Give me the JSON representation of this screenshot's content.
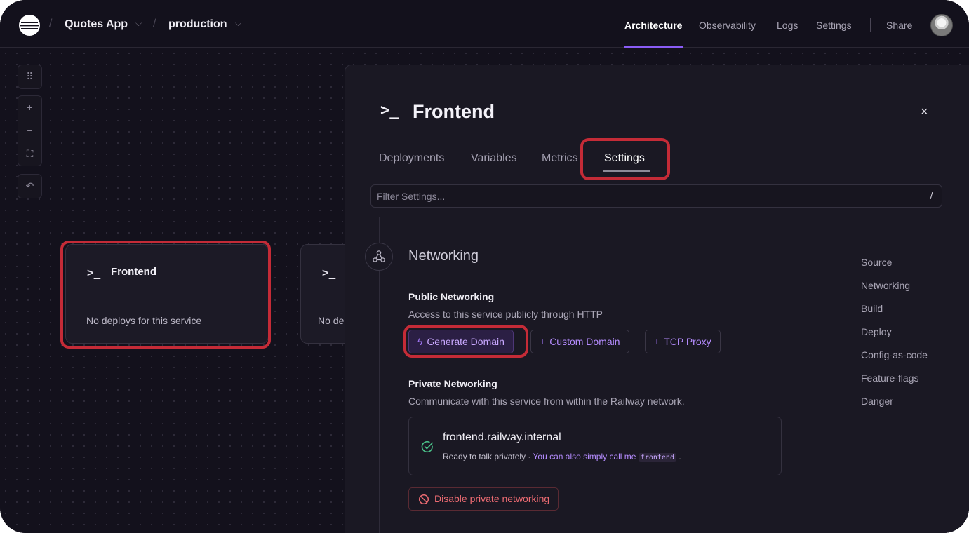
{
  "header": {
    "project": "Quotes App",
    "environment": "production",
    "nav": [
      "Architecture",
      "Observability",
      "Logs",
      "Settings"
    ],
    "share": "Share"
  },
  "canvas": {
    "controls": {
      "grid": "⠿",
      "zoom_in": "+",
      "zoom_out": "−",
      "fit": "⛶",
      "undo": "↶"
    },
    "cards": [
      {
        "prompt": ">_",
        "name": "Frontend",
        "message": "No deploys for this service"
      },
      {
        "prompt": ">_",
        "name": "",
        "message": "No de"
      }
    ]
  },
  "panel": {
    "prompt": ">_",
    "title": "Frontend",
    "close": "×",
    "tabs": [
      "Deployments",
      "Variables",
      "Metrics",
      "Settings"
    ],
    "active_tab": "Settings",
    "filter": {
      "placeholder": "Filter Settings...",
      "shortcut": "/"
    },
    "section_title": "Networking",
    "public": {
      "title": "Public Networking",
      "description": "Access to this service publicly through HTTP",
      "buttons": [
        {
          "icon": "lightning-icon",
          "label": "Generate Domain"
        },
        {
          "icon": "plus-icon",
          "label": "Custom Domain"
        },
        {
          "icon": "plus-icon",
          "label": "TCP Proxy"
        }
      ]
    },
    "private": {
      "title": "Private Networking",
      "description": "Communicate with this service from within the Railway network.",
      "domain": "frontend.railway.internal",
      "status": "Ready to talk privately · ",
      "hint": "You can also simply call me ",
      "alias": "frontend",
      "trailing": " .",
      "disable_label": "Disable private networking"
    },
    "side_nav": [
      "Source",
      "Networking",
      "Build",
      "Deploy",
      "Config-as-code",
      "Feature-flags",
      "Danger"
    ]
  },
  "colors": {
    "accent": "#8a5cf6",
    "highlight": "#c42b37",
    "success": "#4ac28a",
    "danger": "#ec6b72"
  }
}
